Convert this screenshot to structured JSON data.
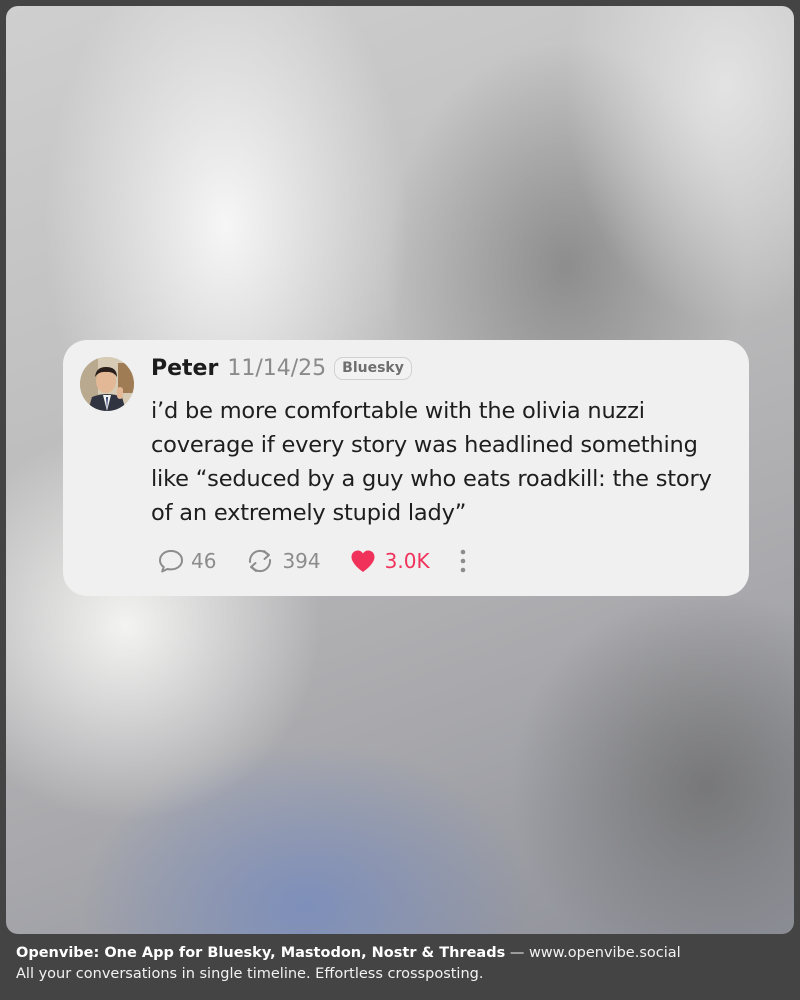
{
  "post": {
    "author": "Peter",
    "date": "11/14/25",
    "platform_badge": "Bluesky",
    "text": "i’d be more comfortable with the olivia nuzzi coverage if every story was headlined something like “seduced by a guy who eats roadkill: the story of an extremely stupid lady”",
    "replies": "46",
    "reposts": "394",
    "likes": "3.0K",
    "like_color": "#f0325b",
    "icons": {
      "reply": "speech-bubble-icon",
      "repost": "repost-arrows-icon",
      "like": "heart-icon",
      "more": "vertical-dots-icon"
    }
  },
  "footer": {
    "headline": "Openvibe: One App for Bluesky, Mastodon, Nostr & Threads",
    "separator": " — ",
    "url": "www.openvibe.social",
    "tagline": "All your conversations in single timeline. Effortless crossposting."
  }
}
